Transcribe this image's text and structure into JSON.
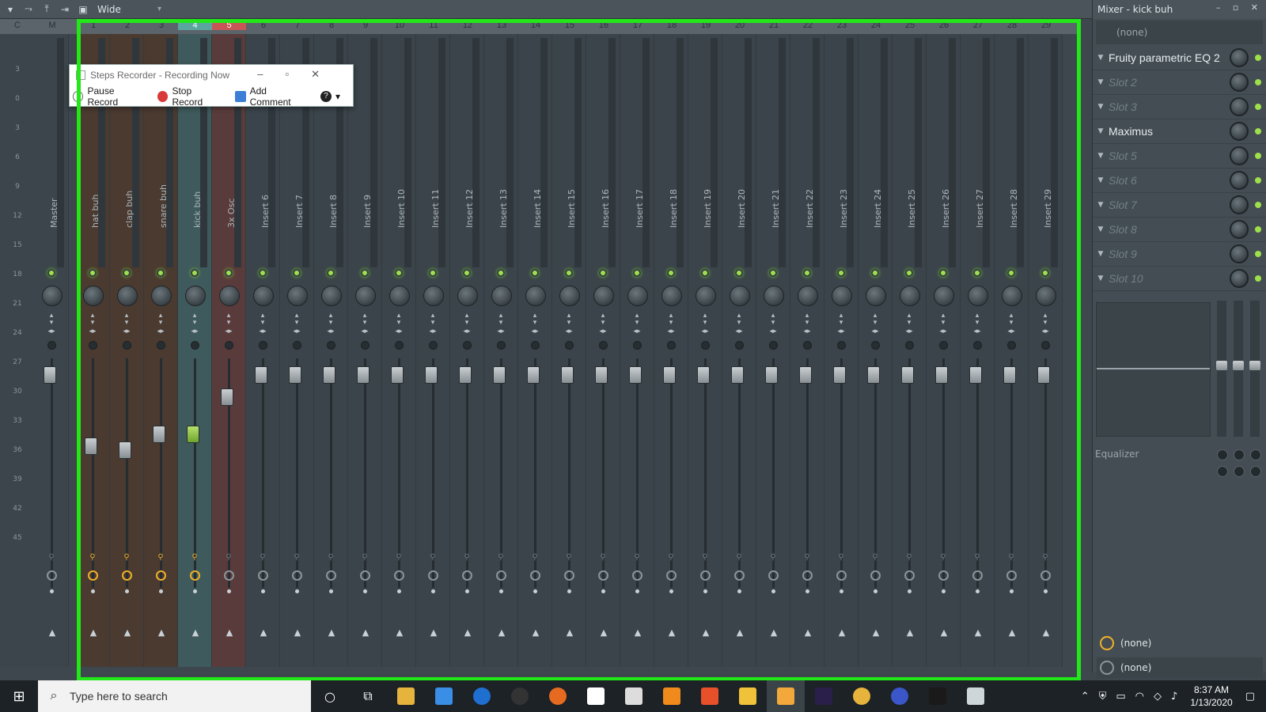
{
  "toolbar": {
    "layout_label": "Wide"
  },
  "ruler": {
    "labels": [
      "C",
      "M",
      "1",
      "2",
      "3",
      "4",
      "5",
      "6",
      "7",
      "8",
      "9",
      "10",
      "11",
      "12",
      "13",
      "14",
      "15",
      "16",
      "17",
      "18",
      "19",
      "20",
      "21",
      "22",
      "23",
      "24",
      "25",
      "26",
      "27",
      "28",
      "29"
    ]
  },
  "scale": [
    "3",
    "0",
    "3",
    "6",
    "9",
    "12",
    "15",
    "18",
    "21",
    "24",
    "27",
    "30",
    "33",
    "36",
    "39",
    "42",
    "45"
  ],
  "strips": [
    {
      "name": "Master",
      "type": "master"
    },
    {
      "name": "hat buh",
      "type": "special"
    },
    {
      "name": "clap buh",
      "type": "special"
    },
    {
      "name": "snare buh",
      "type": "special"
    },
    {
      "name": "kick buh",
      "type": "selected"
    },
    {
      "name": "3x Osc",
      "type": "red"
    },
    {
      "name": "Insert 6",
      "type": "normal"
    },
    {
      "name": "Insert 7",
      "type": "normal"
    },
    {
      "name": "Insert 8",
      "type": "normal"
    },
    {
      "name": "Insert 9",
      "type": "normal"
    },
    {
      "name": "Insert 10",
      "type": "normal"
    },
    {
      "name": "Insert 11",
      "type": "normal"
    },
    {
      "name": "Insert 12",
      "type": "normal"
    },
    {
      "name": "Insert 13",
      "type": "normal"
    },
    {
      "name": "Insert 14",
      "type": "normal"
    },
    {
      "name": "Insert 15",
      "type": "normal"
    },
    {
      "name": "Insert 16",
      "type": "normal"
    },
    {
      "name": "Insert 17",
      "type": "normal"
    },
    {
      "name": "Insert 18",
      "type": "normal"
    },
    {
      "name": "Insert 19",
      "type": "normal"
    },
    {
      "name": "Insert 20",
      "type": "normal"
    },
    {
      "name": "Insert 21",
      "type": "normal"
    },
    {
      "name": "Insert 22",
      "type": "normal"
    },
    {
      "name": "Insert 23",
      "type": "normal"
    },
    {
      "name": "Insert 24",
      "type": "normal"
    },
    {
      "name": "Insert 25",
      "type": "normal"
    },
    {
      "name": "Insert 26",
      "type": "normal"
    },
    {
      "name": "Insert 27",
      "type": "normal"
    },
    {
      "name": "Insert 28",
      "type": "normal"
    },
    {
      "name": "Insert 29",
      "type": "normal"
    }
  ],
  "mixer_panel": {
    "title": "Mixer - kick buh",
    "input": "(none)",
    "slots": [
      {
        "label": "Fruity parametric EQ 2",
        "filled": true
      },
      {
        "label": "Slot 2",
        "filled": false
      },
      {
        "label": "Slot 3",
        "filled": false
      },
      {
        "label": "Maximus",
        "filled": true
      },
      {
        "label": "Slot 5",
        "filled": false
      },
      {
        "label": "Slot 6",
        "filled": false
      },
      {
        "label": "Slot 7",
        "filled": false
      },
      {
        "label": "Slot 8",
        "filled": false
      },
      {
        "label": "Slot 9",
        "filled": false
      },
      {
        "label": "Slot 10",
        "filled": false
      }
    ],
    "eq_label": "Equalizer",
    "output1": "(none)",
    "output2": "(none)"
  },
  "steps_recorder": {
    "title": "Steps Recorder - Recording Now",
    "pause": "Pause Record",
    "stop": "Stop Record",
    "comment": "Add Comment"
  },
  "taskbar": {
    "search_placeholder": "Type here to search",
    "time": "8:37 AM",
    "date": "1/13/2020"
  },
  "colors": {
    "highlight": "#22e81a",
    "led_green": "#9ee04a",
    "accent_orange": "#f0b02a"
  }
}
